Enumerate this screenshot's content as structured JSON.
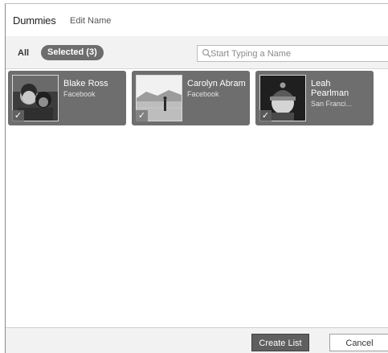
{
  "header": {
    "list_name": "Dummies",
    "edit_link": "Edit Name"
  },
  "filter": {
    "tab_all": "All",
    "tab_selected": "Selected (3)",
    "search_placeholder": "Start Typing a Name",
    "search_value": ""
  },
  "people": [
    {
      "name": "Blake Ross",
      "network": "Facebook",
      "selected": true
    },
    {
      "name": "Carolyn Abram",
      "network": "Facebook",
      "selected": true
    },
    {
      "name": "Leah Pearlman",
      "network": "San Franci...",
      "selected": true
    }
  ],
  "check_glyph": "✓",
  "footer": {
    "create_label": "Create List",
    "cancel_label": "Cancel"
  },
  "colors": {
    "card_bg": "#6e6e6e",
    "selected_pill": "#6d6d6d",
    "primary_button": "#5f5f5f"
  }
}
